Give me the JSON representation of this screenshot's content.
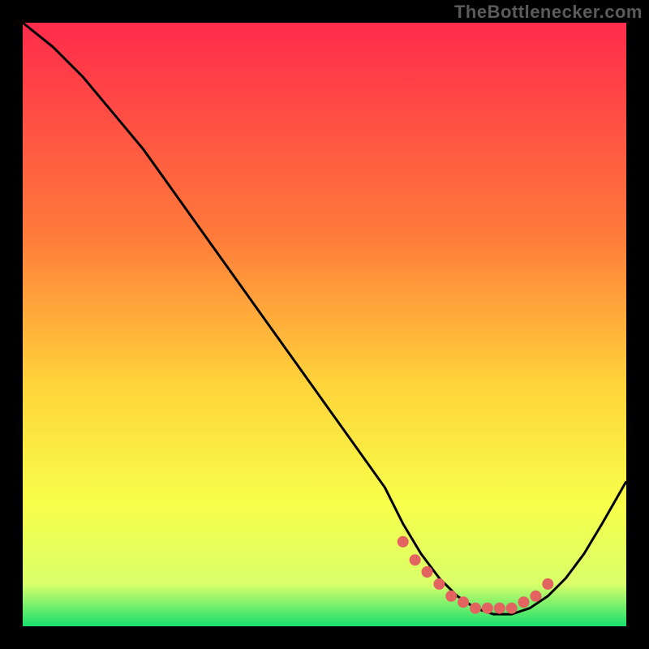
{
  "watermark": "TheBottlenecker.com",
  "colors": {
    "page_bg": "#000000",
    "curve": "#000000",
    "dot_fill": "#e2635f",
    "grad_top": "#ff2b4c",
    "grad_mid1": "#ff7a3a",
    "grad_mid2": "#ffd43a",
    "grad_mid3": "#f7ff4a",
    "grad_low": "#d9ff6a",
    "grad_bottom": "#18e06c"
  },
  "chart_data": {
    "type": "line",
    "title": "",
    "xlabel": "",
    "ylabel": "",
    "xlim": [
      0,
      100
    ],
    "ylim": [
      0,
      100
    ],
    "grid": false,
    "series": [
      {
        "name": "bottleneck-curve",
        "x": [
          0,
          5,
          10,
          15,
          20,
          25,
          30,
          35,
          40,
          45,
          50,
          55,
          60,
          63,
          66,
          69,
          72,
          75,
          78,
          81,
          84,
          87,
          90,
          93,
          96,
          100
        ],
        "y": [
          100,
          96,
          91,
          85,
          79,
          72,
          65,
          58,
          51,
          44,
          37,
          30,
          23,
          17,
          12,
          8,
          5,
          3,
          2,
          2,
          3,
          5,
          8,
          12,
          17,
          24
        ]
      }
    ],
    "dots": {
      "name": "optimal-zone-dots",
      "x": [
        63,
        65,
        67,
        69,
        71,
        73,
        75,
        77,
        79,
        81,
        83,
        85,
        87
      ],
      "y": [
        14,
        11,
        9,
        7,
        5,
        4,
        3,
        3,
        3,
        3,
        4,
        5,
        7
      ]
    }
  }
}
